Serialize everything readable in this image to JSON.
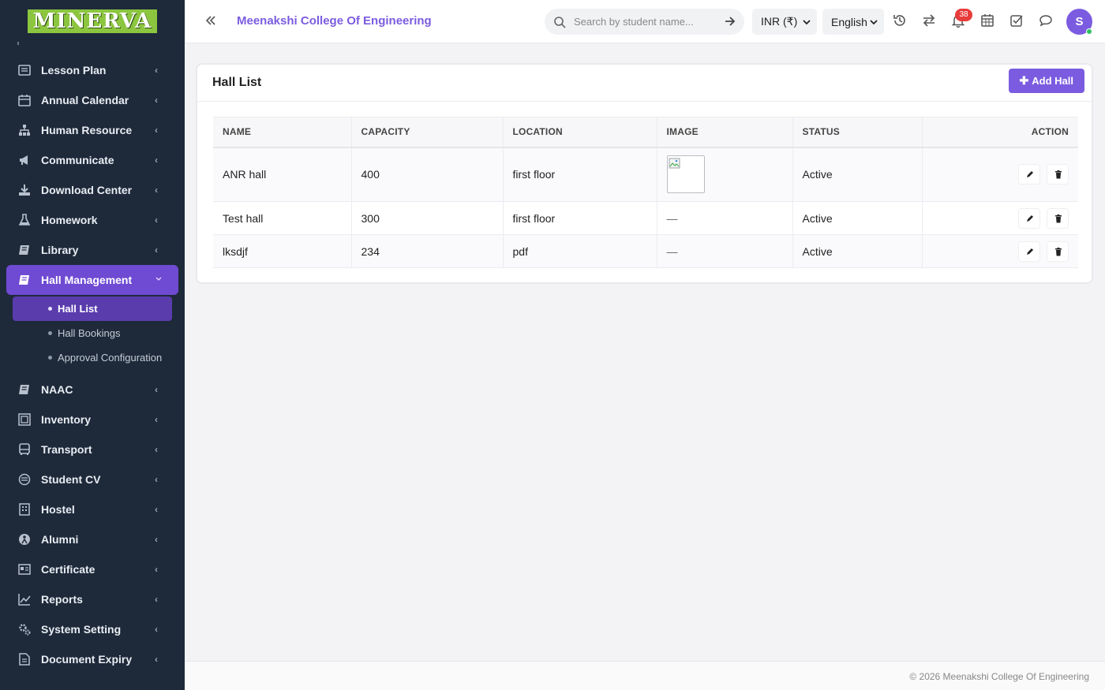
{
  "brand": {
    "logo_text": "MINERVA",
    "accent": "#7b5ce0"
  },
  "sidebar": {
    "items": [
      {
        "label": "Lesson Plan",
        "icon": "lesson-plan-icon"
      },
      {
        "label": "Annual Calendar",
        "icon": "calendar-icon"
      },
      {
        "label": "Human Resource",
        "icon": "sitemap-icon"
      },
      {
        "label": "Communicate",
        "icon": "bullhorn-icon"
      },
      {
        "label": "Download Center",
        "icon": "download-icon"
      },
      {
        "label": "Homework",
        "icon": "flask-icon"
      },
      {
        "label": "Library",
        "icon": "book-icon"
      },
      {
        "label": "Hall Management",
        "icon": "book-icon",
        "active": true
      },
      {
        "label": "NAAC",
        "icon": "book-icon"
      },
      {
        "label": "Inventory",
        "icon": "inventory-icon"
      },
      {
        "label": "Transport",
        "icon": "bus-icon"
      },
      {
        "label": "Student CV",
        "icon": "cv-icon"
      },
      {
        "label": "Hostel",
        "icon": "building-icon"
      },
      {
        "label": "Alumni",
        "icon": "alumni-icon"
      },
      {
        "label": "Certificate",
        "icon": "certificate-icon"
      },
      {
        "label": "Reports",
        "icon": "line-chart-icon"
      },
      {
        "label": "System Setting",
        "icon": "gears-icon"
      },
      {
        "label": "Document Expiry",
        "icon": "document-icon"
      }
    ],
    "hall_submenu": [
      "Hall List",
      "Hall Bookings",
      "Approval Configuration"
    ]
  },
  "header": {
    "college_name": "Meenakshi College Of Engineering",
    "search_placeholder": "Search by student name...",
    "currency": "INR (₹)",
    "language": "English",
    "notification_count": "38",
    "avatar_initial": "S"
  },
  "card": {
    "title": "Hall List",
    "add_button": "Add Hall",
    "columns": [
      "NAME",
      "CAPACITY",
      "LOCATION",
      "IMAGE",
      "STATUS",
      "ACTION"
    ],
    "rows": [
      {
        "name": "ANR hall",
        "capacity": "400",
        "location": "first floor",
        "image": "",
        "status": "Active"
      },
      {
        "name": "Test hall",
        "capacity": "300",
        "location": "first floor",
        "image": "—",
        "status": "Active"
      },
      {
        "name": "lksdjf",
        "capacity": "234",
        "location": "pdf",
        "image": "—",
        "status": "Active"
      }
    ]
  },
  "footer": {
    "text": "© 2026 Meenakshi College Of Engineering"
  }
}
